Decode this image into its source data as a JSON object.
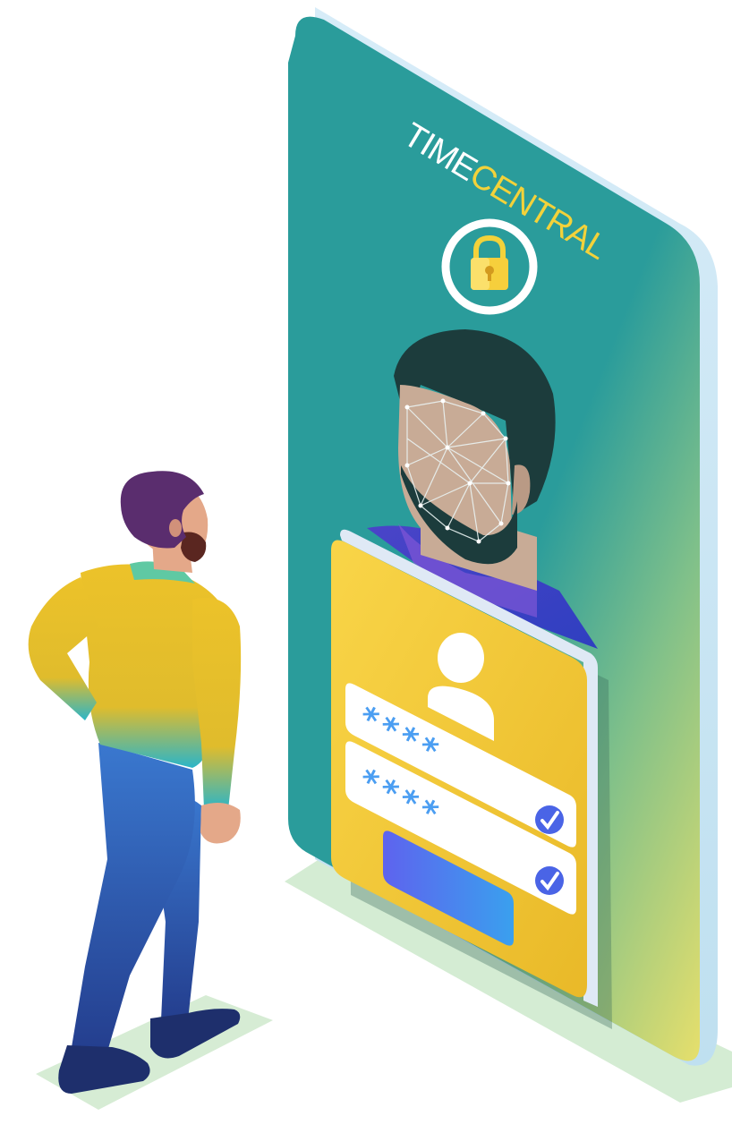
{
  "brand": {
    "part1": "TIME",
    "part2": "CENTRAL",
    "color1": "#ffffff",
    "color2": "#f3d23a"
  },
  "icons": {
    "lock": "padlock-icon",
    "face": "face-scan-icon",
    "user": "user-avatar-icon",
    "check": "checkmark-icon"
  },
  "login_form": {
    "field1_value": "****",
    "field2_value": "****",
    "submit_label": ""
  },
  "colors": {
    "phone_teal": "#2a9c9b",
    "phone_edge": "#c9e6f4",
    "card_yellow": "#f6cd3c",
    "button_blue": "#5a6df0",
    "check_blue": "#4a64e6",
    "ground_green": "#d3ebd0"
  }
}
